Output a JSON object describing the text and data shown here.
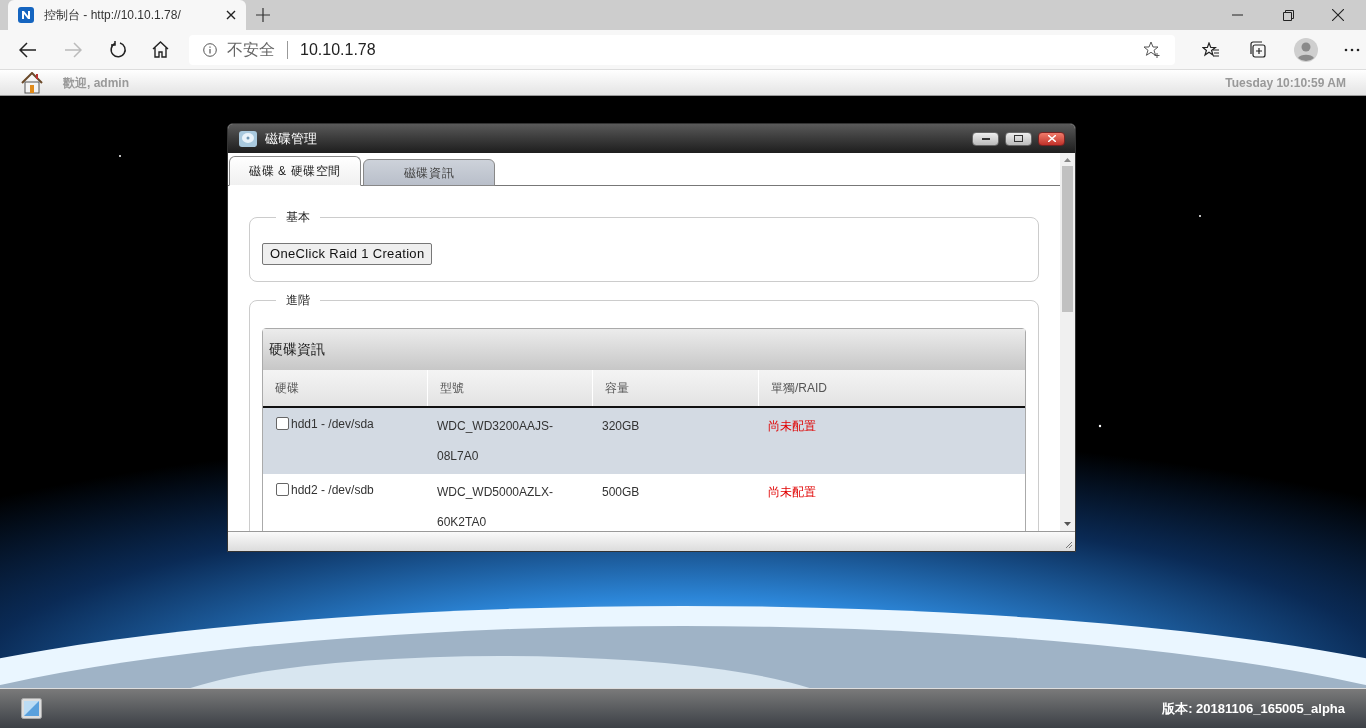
{
  "browser": {
    "tab_title": "控制台 - http://10.10.1.78/",
    "security": "不安全",
    "url": "10.10.1.78"
  },
  "app_bar": {
    "welcome": "歡迎, admin",
    "time": "Tuesday 10:10:59 AM"
  },
  "window": {
    "title": "磁碟管理",
    "tabs": [
      {
        "label": "磁碟 & 硬碟空間",
        "selected": true
      },
      {
        "label": "磁碟資訊",
        "selected": false
      }
    ],
    "basic": {
      "legend": "基本",
      "button": "OneClick Raid 1 Creation"
    },
    "advanced": {
      "legend": "進階",
      "panel_title": "硬碟資訊",
      "columns": [
        "硬碟",
        "型號",
        "容量",
        "單獨/RAID"
      ],
      "rows": [
        {
          "disk": "hdd1 - /dev/sda",
          "model": "WDC_WD3200AAJS-08L7A0",
          "capacity": "320GB",
          "raid": "尚未配置",
          "checked": false,
          "selected": true
        },
        {
          "disk": "hdd2 - /dev/sdb",
          "model": "WDC_WD5000AZLX-60K2TA0",
          "capacity": "500GB",
          "raid": "尚未配置",
          "checked": false,
          "selected": false
        }
      ]
    }
  },
  "taskbar": {
    "version": "版本: 20181106_165005_alpha"
  }
}
